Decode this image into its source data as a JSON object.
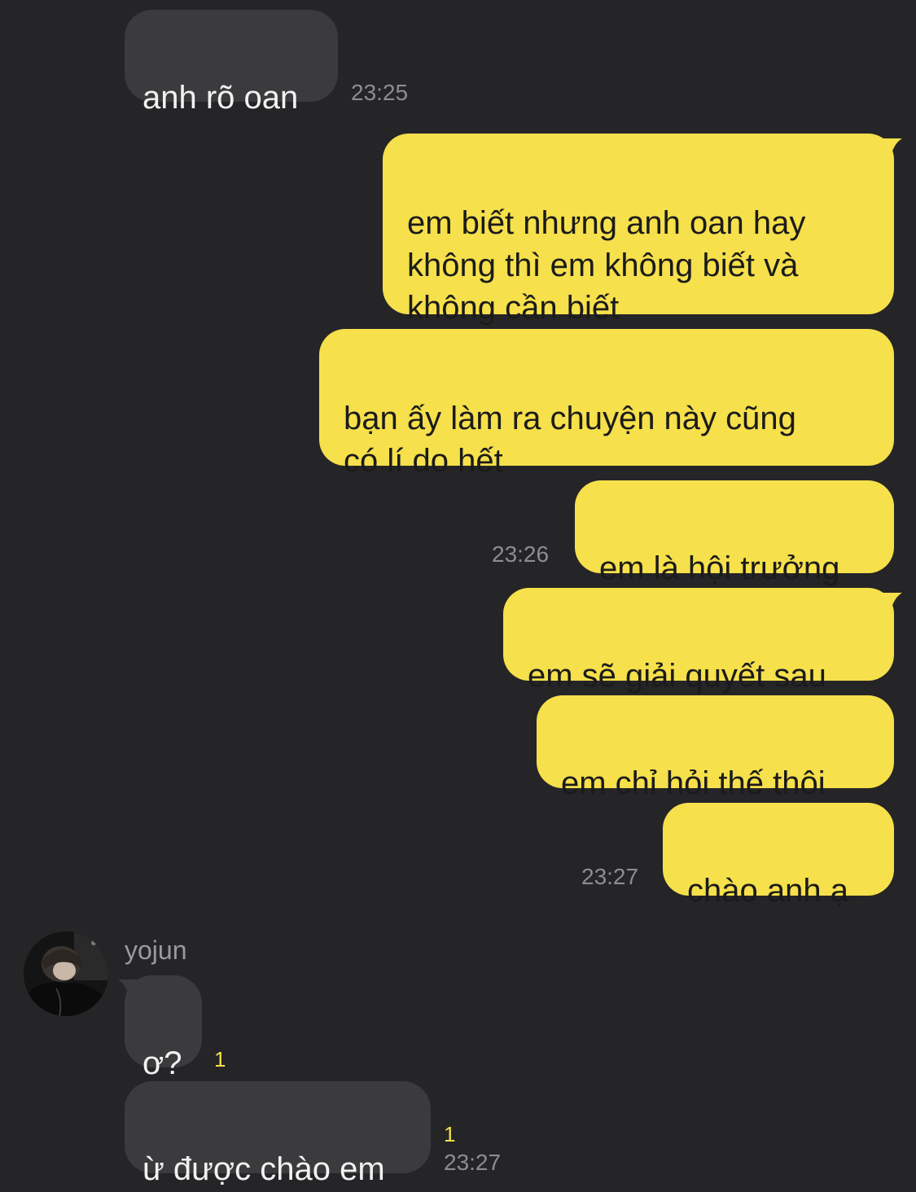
{
  "colors": {
    "background": "#252527",
    "incoming_bubble": "#3b3b3d",
    "outgoing_bubble": "#f6e04b",
    "timestamp": "#8d8d8f",
    "unread": "#f6e04b"
  },
  "contact": {
    "name": "yojun",
    "avatar_icon": "profile-photo"
  },
  "messages": [
    {
      "direction": "in",
      "text": "anh rõ oan",
      "time": "23:25"
    },
    {
      "direction": "out",
      "text": "em biết nhưng anh oan hay\nkhông thì em không biết và\nkhông cần biết"
    },
    {
      "direction": "out",
      "text": "bạn ấy làm ra chuyện này cũng\ncó lí do hết"
    },
    {
      "direction": "out",
      "text": "em là hội trưởng",
      "time": "23:26"
    },
    {
      "direction": "out",
      "text": "em sẽ giải quyết sau"
    },
    {
      "direction": "out",
      "text": "em chỉ hỏi thế thôi"
    },
    {
      "direction": "out",
      "text": "chào anh ạ",
      "time": "23:27"
    },
    {
      "direction": "in",
      "text": "ơ?",
      "unread": "1"
    },
    {
      "direction": "in",
      "text": "ừ được chào em",
      "unread": "1",
      "time": "23:27"
    }
  ]
}
